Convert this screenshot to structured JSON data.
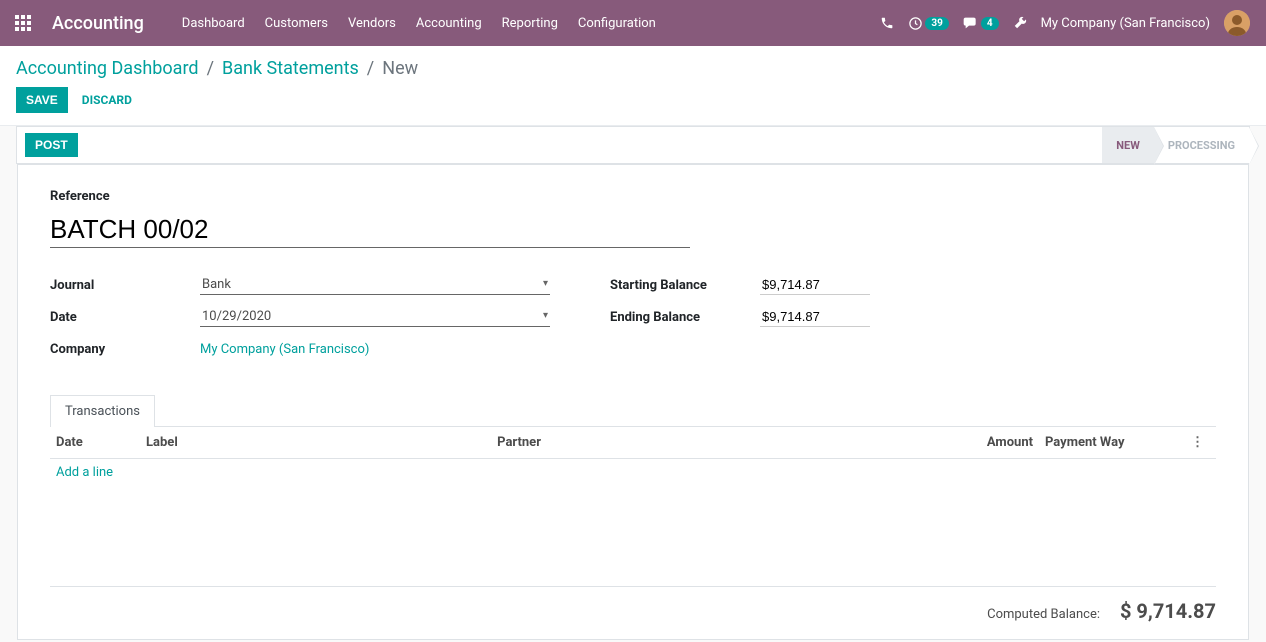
{
  "app_title": "Accounting",
  "nav": [
    "Dashboard",
    "Customers",
    "Vendors",
    "Accounting",
    "Reporting",
    "Configuration"
  ],
  "systray": {
    "activities_badge": "39",
    "messages_badge": "4",
    "company": "My Company (San Francisco)"
  },
  "breadcrumb": {
    "a": "Accounting Dashboard",
    "b": "Bank Statements",
    "current": "New"
  },
  "buttons": {
    "save": "Save",
    "discard": "Discard",
    "post": "Post"
  },
  "status": {
    "new": "New",
    "processing": "Processing"
  },
  "form": {
    "reference_label": "Reference",
    "reference_value": "BATCH 00/02",
    "journal_label": "Journal",
    "journal_value": "Bank",
    "date_label": "Date",
    "date_value": "10/29/2020",
    "company_label": "Company",
    "company_value": "My Company (San Francisco)",
    "starting_label": "Starting Balance",
    "starting_value": "$9,714.87",
    "ending_label": "Ending Balance",
    "ending_value": "$9,714.87"
  },
  "tabs": {
    "transactions": "Transactions"
  },
  "table": {
    "cols": {
      "date": "Date",
      "label": "Label",
      "partner": "Partner",
      "amount": "Amount",
      "payment_way": "Payment Way"
    },
    "add_line": "Add a line"
  },
  "footer": {
    "computed_label": "Computed Balance:",
    "computed_value": "$ 9,714.87"
  }
}
